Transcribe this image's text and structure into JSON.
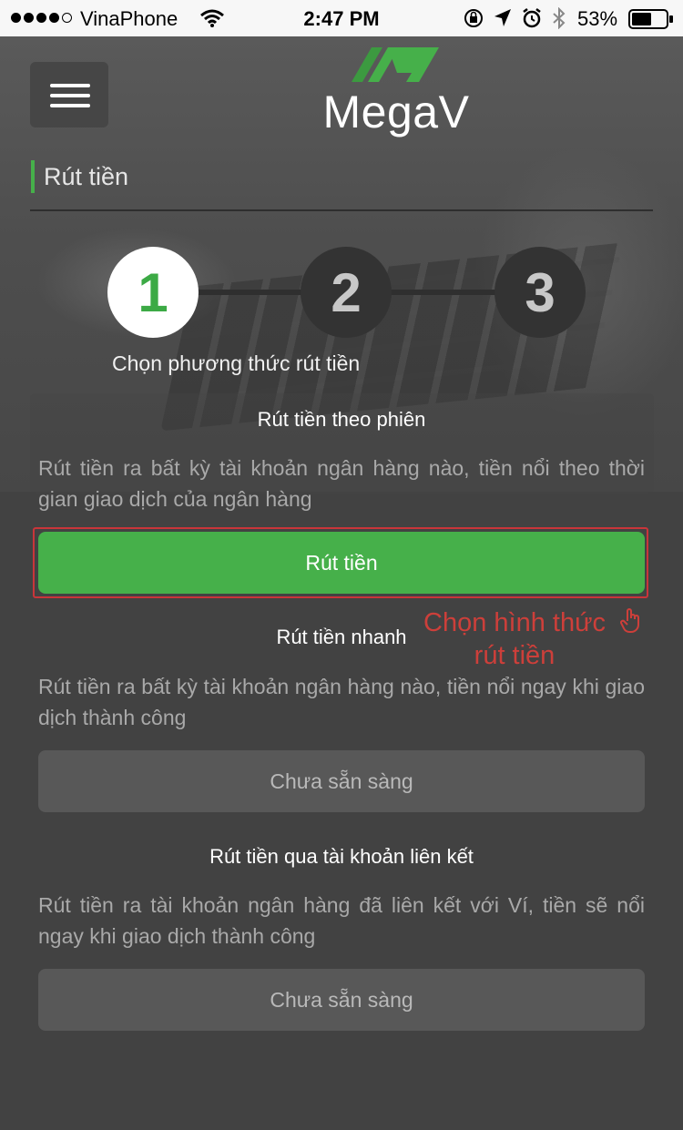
{
  "status_bar": {
    "carrier": "VinaPhone",
    "time": "2:47 PM",
    "battery_percent": "53%",
    "signal_bars": 4,
    "icons": [
      "signal-icon",
      "wifi-icon",
      "rotation-lock-icon",
      "location-arrow-icon",
      "alarm-icon",
      "bluetooth-icon",
      "battery-icon"
    ]
  },
  "header": {
    "logo_text": "MegaV",
    "brand_color": "#46b04a",
    "menu_icon": "hamburger-menu-icon"
  },
  "page": {
    "title": "Rút tiền"
  },
  "stepper": {
    "steps": [
      "1",
      "2",
      "3"
    ],
    "active_step": 1,
    "active_caption": "Chọn phương thức rút tiền"
  },
  "options": [
    {
      "title": "Rút tiền theo phiên",
      "description": "Rút tiền ra bất kỳ tài khoản ngân hàng nào, tiền nổi theo thời gian giao dịch của ngân hàng",
      "button_label": "Rút tiền"
    },
    {
      "title": "Rút tiền nhanh",
      "description": "Rút tiền ra bất kỳ tài khoản ngân hàng nào, tiền nổi ngay khi giao dịch thành công",
      "button_label": "Chưa sẵn sàng"
    },
    {
      "title": "Rút tiền qua tài khoản liên kết",
      "description": "Rút tiền ra tài khoản ngân hàng đã liên kết với Ví, tiền sẽ nổi ngay khi giao dịch thành công",
      "button_label": "Chưa sẵn sàng"
    }
  ],
  "annotation": {
    "text_line1": "Chọn hình thức",
    "text_line2": "rút tiền",
    "color": "#cd3f3a",
    "icon": "hand-pointer-icon"
  }
}
